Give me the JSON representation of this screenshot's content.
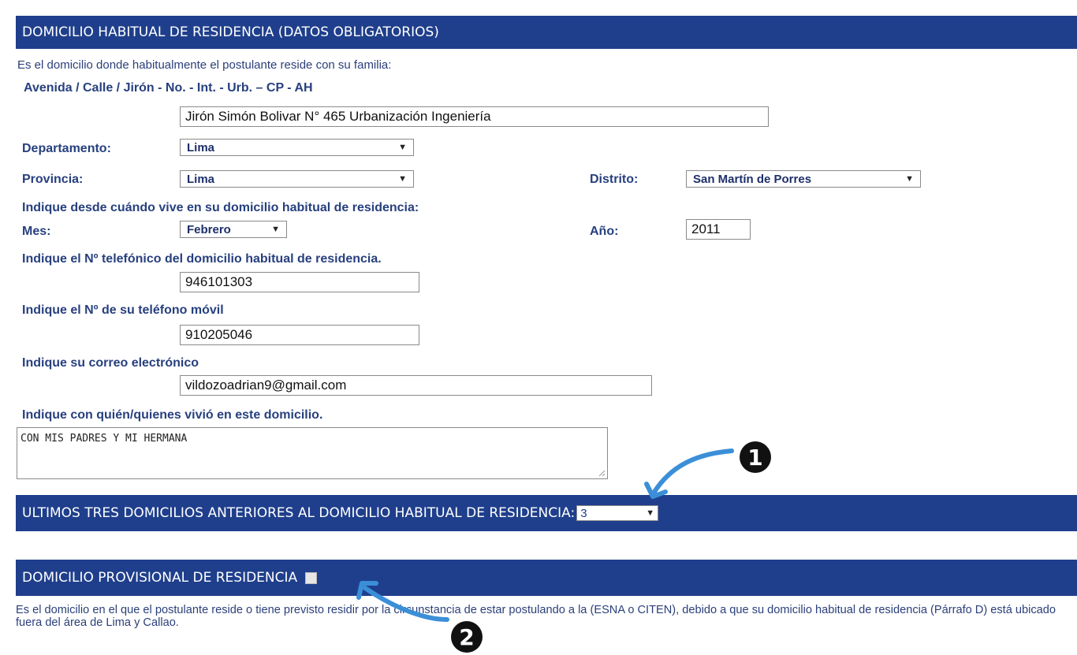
{
  "section_main": {
    "title": "DOMICILIO HABITUAL DE RESIDENCIA (DATOS OBLIGATORIOS)",
    "intro": "Es el domicilio donde habitualmente el postulante reside con su familia:",
    "address_label": "Avenida / Calle / Jirón - No. - Int. - Urb. – CP - AH",
    "address_value": "Jirón Simón Bolivar N° 465 Urbanización Ingeniería",
    "departamento_label": "Departamento:",
    "departamento_value": "Lima",
    "provincia_label": "Provincia:",
    "provincia_value": "Lima",
    "distrito_label": "Distrito:",
    "distrito_value": "San Martín de Porres",
    "since_label": "Indique desde cuándo vive en su domicilio habitual de residencia:",
    "mes_label": "Mes:",
    "mes_value": "Febrero",
    "anio_label": "Año:",
    "anio_value": "2011",
    "phone_label": "Indique el Nº telefónico del domicilio habitual de residencia.",
    "phone_value": "946101303",
    "mobile_label": "Indique el Nº de su teléfono móvil",
    "mobile_value": "910205046",
    "email_label": "Indique su correo electrónico",
    "email_value": "vildozoadrian9@gmail.com",
    "lived_with_label": "Indique con quién/quienes vivió en este domicilio.",
    "lived_with_value": "CON MIS PADRES Y MI HERMANA"
  },
  "section_previous": {
    "title": "ULTIMOS TRES DOMICILIOS ANTERIORES AL DOMICILIO HABITUAL DE RESIDENCIA:",
    "count_value": "3"
  },
  "section_provisional": {
    "title": "DOMICILIO PROVISIONAL DE RESIDENCIA",
    "description": "Es el domicilio en el que el postulante reside o tiene previsto residir por la circunstancia de estar postulando a la (ESNA o CITEN), debido a que su domicilio habitual de residencia (Párrafo D) está ubicado fuera del área de Lima y Callao."
  },
  "annotations": {
    "marker_1": "1",
    "marker_2": "2"
  },
  "colors": {
    "header_bar": "#1f3f8c",
    "label_text": "#27407e",
    "annotation_arrow": "#3b8fd8"
  },
  "icons": {
    "dropdown": "triangle-down",
    "resize_grip": "resize-grip"
  }
}
